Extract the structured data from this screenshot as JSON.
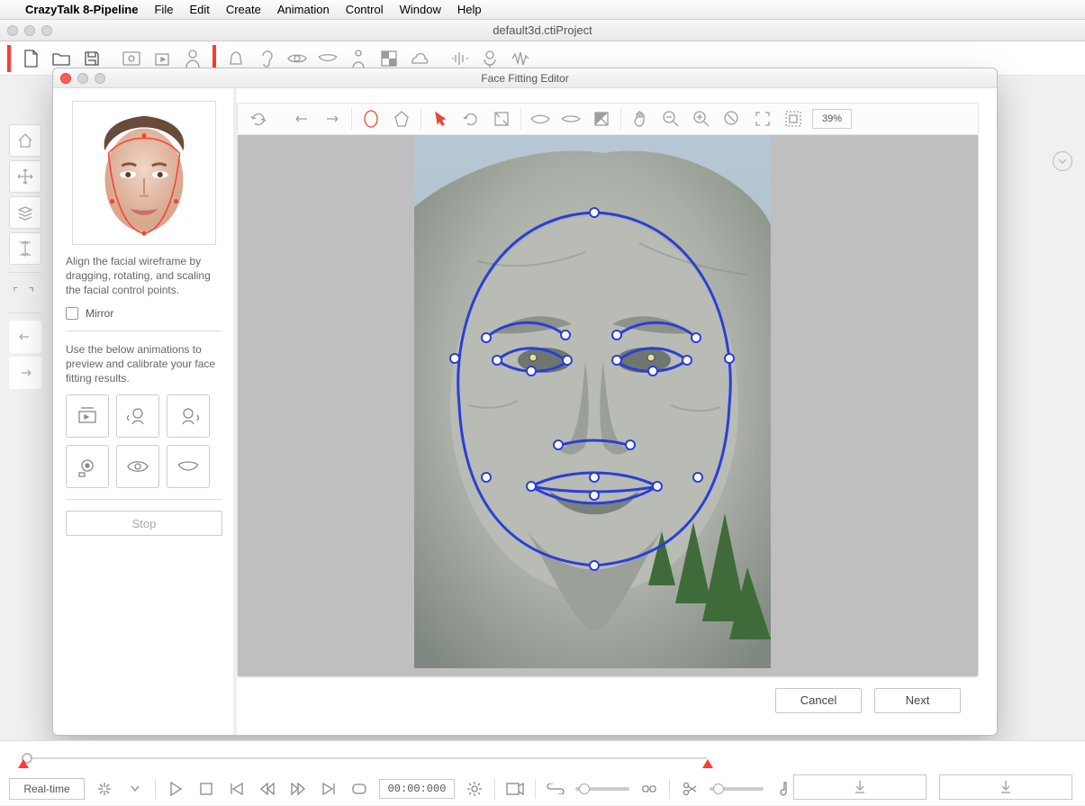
{
  "menubar": {
    "app_name": "CrazyTalk 8-Pipeline",
    "items": [
      "File",
      "Edit",
      "Create",
      "Animation",
      "Control",
      "Window",
      "Help"
    ]
  },
  "project_window": {
    "title": "default3d.ctiProject"
  },
  "modal": {
    "title": "Face Fitting Editor",
    "left_panel": {
      "instruction1": "Align the facial wireframe by dragging, rotating, and scaling the facial control points.",
      "mirror_label": "Mirror",
      "instruction2": "Use the below animations to preview and calibrate your face fitting results.",
      "stop_label": "Stop"
    },
    "toolbar": {
      "zoom": "39%"
    },
    "footer": {
      "cancel": "Cancel",
      "next": "Next"
    }
  },
  "timeline": {
    "mode": "Real-time",
    "timecode": "00:00:000"
  }
}
